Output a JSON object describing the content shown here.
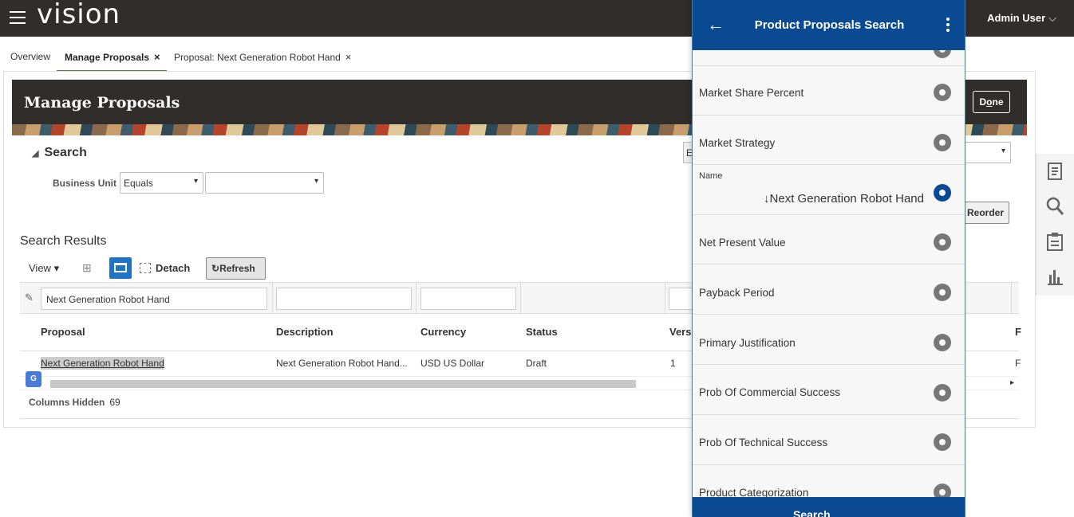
{
  "app": {
    "logo": "vision",
    "user": "Admin User"
  },
  "tabs": [
    {
      "label": "Overview"
    },
    {
      "label": "Manage Proposals",
      "close": "×"
    },
    {
      "label": "Proposal: Next Generation Robot Hand",
      "close": "×"
    }
  ],
  "page": {
    "title": "Manage Proposals",
    "done_label": "Done",
    "done_mnemonic": "o"
  },
  "search": {
    "header": "Search",
    "business_unit_label": "Business Unit",
    "operator_value": "Equals",
    "value": "",
    "right_stub_text": "E",
    "reorder_label": "Reorder"
  },
  "results": {
    "title": "Search Results",
    "view_label": "View",
    "detach_label": "Detach",
    "refresh_label": "Refresh",
    "filter_values": [
      "Next Generation Robot Hand",
      "",
      "",
      ""
    ],
    "columns": [
      "Proposal",
      "Description",
      "Currency",
      "Status",
      "Vers",
      "F"
    ],
    "rows": [
      {
        "proposal": "Next Generation Robot Hand",
        "description": "Next Generation Robot Hand...",
        "currency": "USD US Dollar",
        "status": "Draft",
        "version": "1",
        "last": "F"
      }
    ],
    "columns_hidden_label": "Columns Hidden",
    "columns_hidden_count": "69"
  },
  "panel": {
    "title": "Product Proposals Search",
    "items": [
      {
        "label": "Market Share Percent"
      },
      {
        "label": "Market Strategy"
      },
      {
        "label": "Name",
        "value": "↓Next Generation Robot Hand"
      },
      {
        "label": "Net Present Value"
      },
      {
        "label": "Payback Period"
      },
      {
        "label": "Primary Justification"
      },
      {
        "label": "Prob Of Commercial Success"
      },
      {
        "label": "Prob Of Technical Success"
      },
      {
        "label": "Product Categorization"
      }
    ],
    "footer_label": "Search"
  },
  "colors": {
    "topbar": "#312d2a",
    "panel_header": "#0a4a93",
    "accent_blue": "#1f74c6",
    "tab_underline": "#5a7d3c"
  },
  "icons": [
    "hamburger-icon",
    "chevron-down-icon",
    "back-arrow-icon",
    "kebab-icon",
    "aperture-icon",
    "pencil-icon",
    "refresh-icon",
    "detach-icon",
    "freeze-icon",
    "filter-icon",
    "notes-icon",
    "search-icon",
    "clipboard-icon",
    "bar-chart-icon"
  ]
}
